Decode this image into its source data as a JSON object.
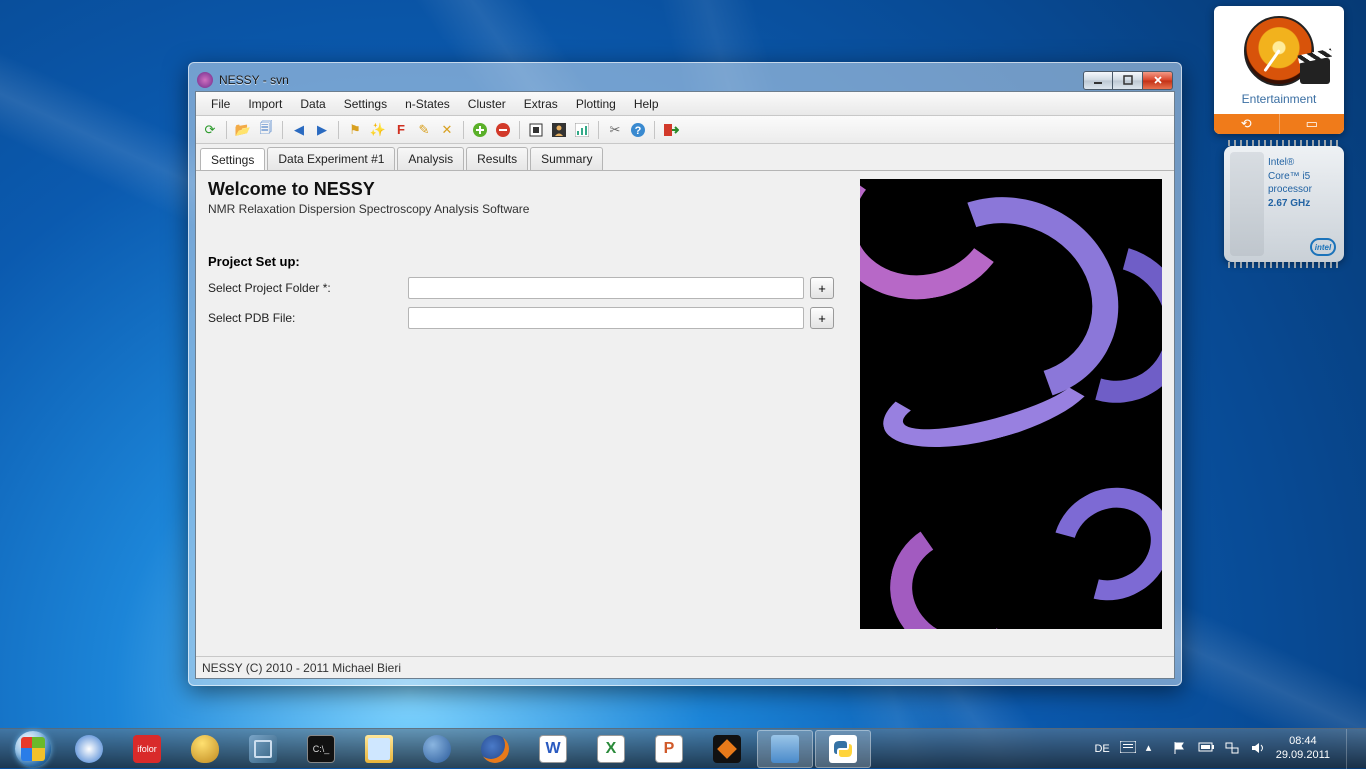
{
  "window": {
    "title": "NESSY - svn",
    "menus": [
      "File",
      "Import",
      "Data",
      "Settings",
      "n-States",
      "Cluster",
      "Extras",
      "Plotting",
      "Help"
    ],
    "tabs": [
      "Settings",
      "Data Experiment #1",
      "Analysis",
      "Results",
      "Summary"
    ],
    "active_tab": 0,
    "welcome_title": "Welcome to NESSY",
    "welcome_sub": "NMR Relaxation Dispersion Spectroscopy Analysis Software",
    "project_setup_heading": "Project Set up:",
    "field_project_label": "Select Project Folder *:",
    "field_project_value": "",
    "field_pdb_label": "Select PDB File:",
    "field_pdb_value": "",
    "browse_label": "+",
    "statusbar": "NESSY (C) 2010 - 2011 Michael Bieri"
  },
  "gadgets": {
    "entertainment_label": "Entertainment",
    "cpu_line1": "Intel®",
    "cpu_line2": "Core™ i5",
    "cpu_line3": "processor",
    "cpu_hz": "2.67 GHz",
    "cpu_logo": "intel"
  },
  "tray": {
    "lang": "DE",
    "time": "08:44",
    "date": "29.09.2011"
  },
  "colors": {
    "close_red": "#c23115",
    "accent_blue": "#0b5aaf"
  }
}
